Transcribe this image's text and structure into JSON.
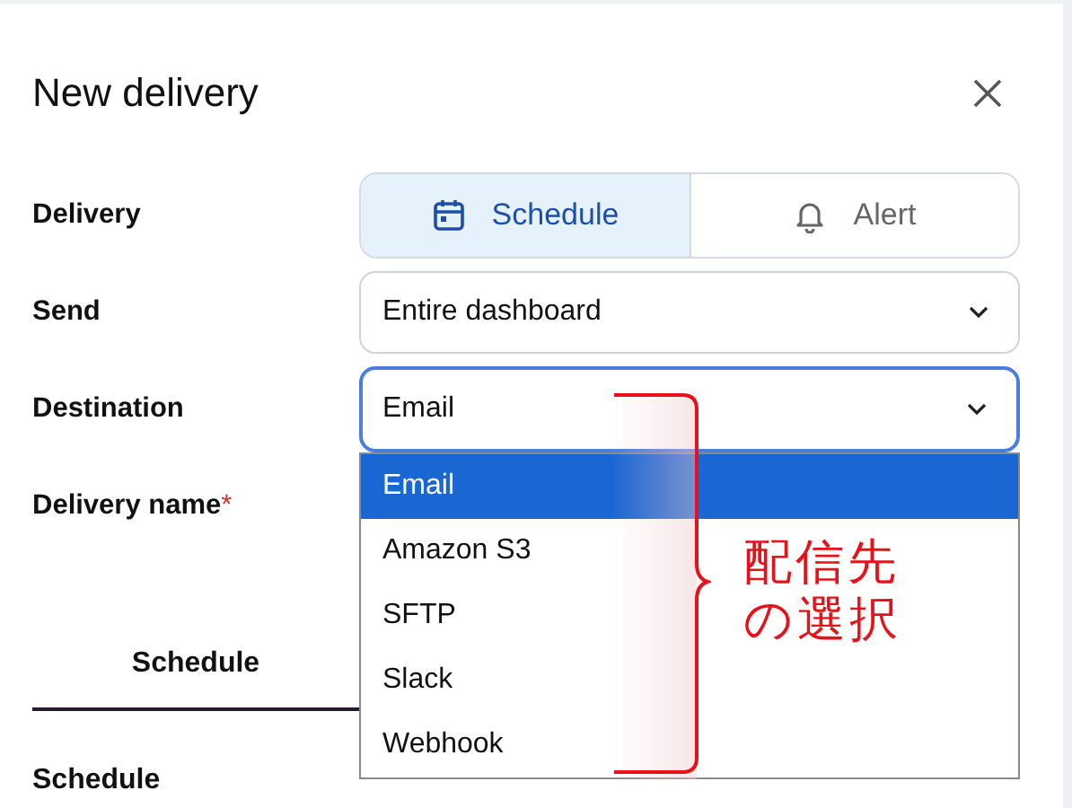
{
  "dialog": {
    "title": "New delivery"
  },
  "delivery": {
    "label": "Delivery",
    "options": [
      {
        "label": "Schedule",
        "selected": true
      },
      {
        "label": "Alert",
        "selected": false
      }
    ]
  },
  "send": {
    "label": "Send",
    "value": "Entire dashboard"
  },
  "destination": {
    "label": "Destination",
    "value": "Email",
    "focused": true,
    "expanded": true,
    "options": [
      {
        "label": "Email",
        "selected": true
      },
      {
        "label": "Amazon S3",
        "selected": false
      },
      {
        "label": "SFTP",
        "selected": false
      },
      {
        "label": "Slack",
        "selected": false
      },
      {
        "label": "Webhook",
        "selected": false
      }
    ]
  },
  "delivery_name": {
    "label": "Delivery name",
    "required": true,
    "required_mark": "*"
  },
  "tabs": [
    {
      "label": "Schedule",
      "selected": true
    }
  ],
  "section_label": "Schedule",
  "annotation": {
    "lines": [
      "配信先",
      "の選択"
    ]
  }
}
